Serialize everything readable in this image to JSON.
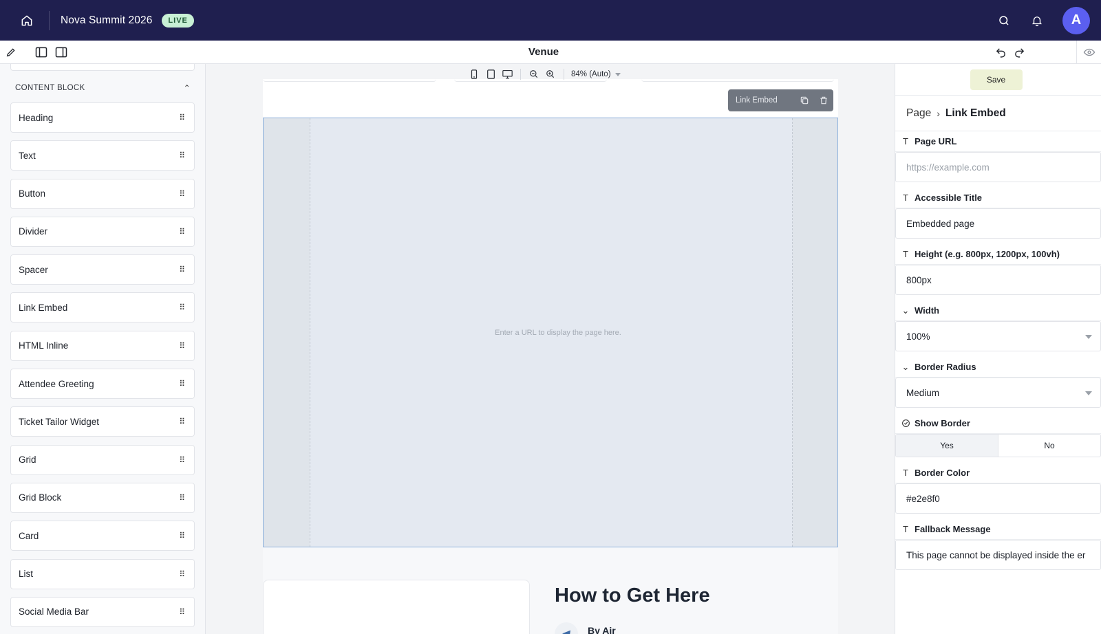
{
  "topbar": {
    "event_title": "Nova Summit 2026",
    "status_badge": "LIVE",
    "avatar_initial": "A"
  },
  "toolbar": {
    "page_name": "Venue"
  },
  "sidebar": {
    "section_title": "CONTENT BLOCK",
    "blocks": [
      {
        "label": "Heading"
      },
      {
        "label": "Text"
      },
      {
        "label": "Button"
      },
      {
        "label": "Divider"
      },
      {
        "label": "Spacer"
      },
      {
        "label": "Link Embed"
      },
      {
        "label": "HTML Inline"
      },
      {
        "label": "Attendee Greeting"
      },
      {
        "label": "Ticket Tailor Widget"
      },
      {
        "label": "Grid"
      },
      {
        "label": "Grid Block"
      },
      {
        "label": "Card"
      },
      {
        "label": "List"
      },
      {
        "label": "Social Media Bar"
      }
    ]
  },
  "canvas": {
    "zoom_label": "84% (Auto)",
    "embed_toolbar_label": "Link Embed",
    "embed_placeholder": "Enter a URL to display the page here.",
    "section_heading": "How to Get Here",
    "by_air_label": "By Air"
  },
  "inspector": {
    "save_label": "Save",
    "breadcrumb_root": "Page",
    "breadcrumb_current": "Link Embed",
    "page_url_label": "Page URL",
    "page_url_placeholder": "https://example.com",
    "accessible_title_label": "Accessible Title",
    "accessible_title_value": "Embedded page",
    "height_label": "Height (e.g. 800px, 1200px, 100vh)",
    "height_value": "800px",
    "width_label": "Width",
    "width_value": "100%",
    "border_radius_label": "Border Radius",
    "border_radius_value": "Medium",
    "show_border_label": "Show Border",
    "show_border_yes": "Yes",
    "show_border_no": "No",
    "border_color_label": "Border Color",
    "border_color_value": "#e2e8f0",
    "fallback_label": "Fallback Message",
    "fallback_value": "This page cannot be displayed inside the er"
  },
  "colors": {
    "topbar_bg": "#1f1f4f",
    "live_badge_bg": "#c8f0d5",
    "avatar_bg": "#5b5ff0",
    "selection_border": "#8fb2dd",
    "save_button_bg": "#eef2d6"
  },
  "icons": [
    "home-icon",
    "search-icon",
    "bell-icon",
    "pencil-icon",
    "panel-left-icon",
    "panel-right-icon",
    "undo-icon",
    "redo-icon",
    "eye-icon",
    "phone-icon",
    "tablet-icon",
    "desktop-icon",
    "zoom-out-icon",
    "zoom-in-icon",
    "copy-icon",
    "trash-icon",
    "text-type-icon",
    "chevron-down-icon",
    "check-circle-icon",
    "plane-icon",
    "grip-icon"
  ]
}
